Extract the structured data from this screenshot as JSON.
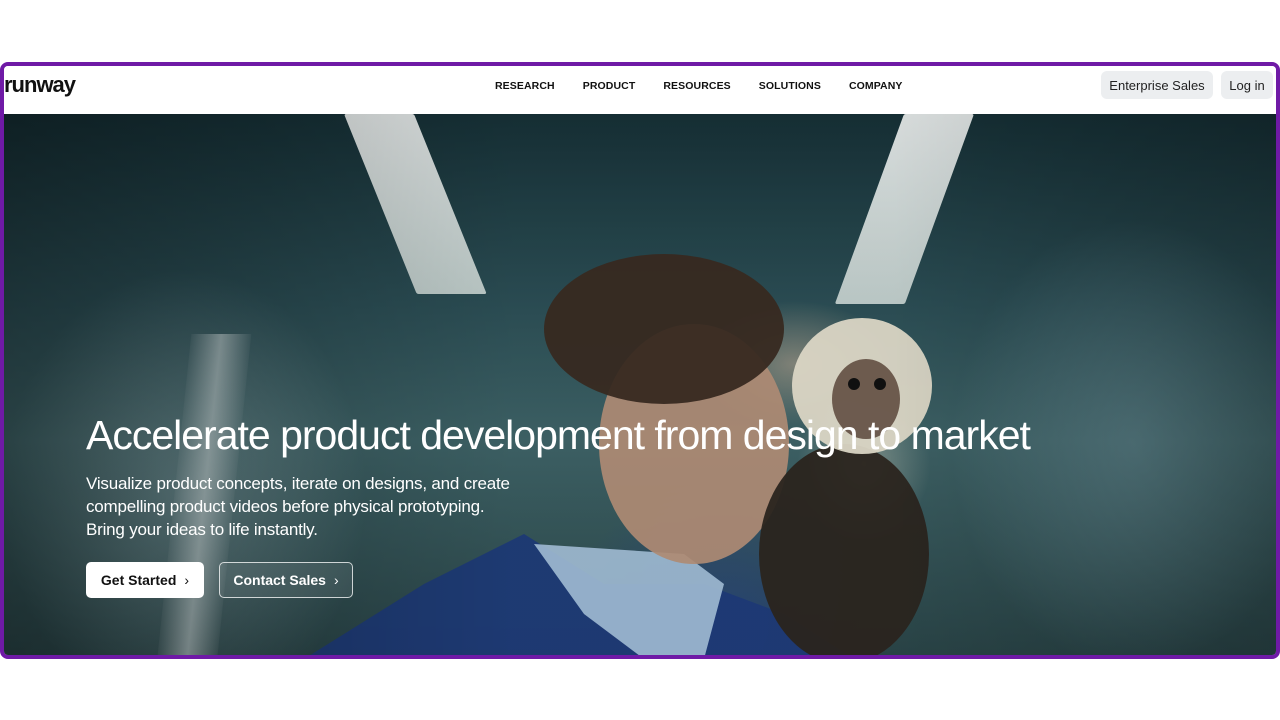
{
  "brand": {
    "logo": "runway"
  },
  "nav": {
    "items": [
      "RESEARCH",
      "PRODUCT",
      "RESOURCES",
      "SOLUTIONS",
      "COMPANY"
    ],
    "enterprise_label": "Enterprise Sales",
    "login_label": "Log in"
  },
  "hero": {
    "title": "Accelerate product development from design to market",
    "subtitle_lines": [
      "Visualize product concepts, iterate on designs, and create",
      "compelling product videos before physical prototyping.",
      "Bring your ideas to life instantly."
    ],
    "primary_cta": "Get Started",
    "secondary_cta": "Contact Sales",
    "chevron_icon": "chevron-right-icon"
  },
  "colors": {
    "frame_border": "#6f1aa6",
    "button_bg": "#eceef0",
    "text_dark": "#111111"
  }
}
